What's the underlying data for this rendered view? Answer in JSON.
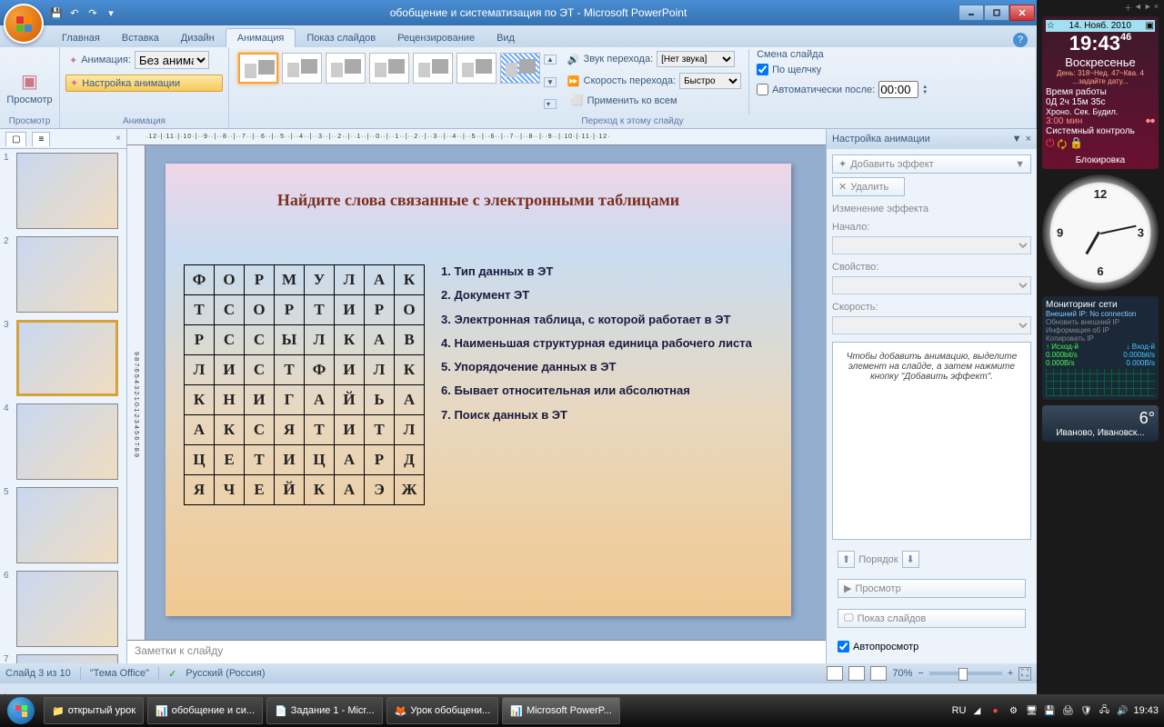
{
  "title": "обобщение и систематизация по ЭТ - Microsoft PowerPoint",
  "tabs": [
    "Главная",
    "Вставка",
    "Дизайн",
    "Анимация",
    "Показ слайдов",
    "Рецензирование",
    "Вид"
  ],
  "active_tab": 3,
  "ribbon": {
    "preview": "Просмотр",
    "anim_label": "Анимация:",
    "anim_value": "Без анимац...",
    "custom_anim": "Настройка анимации",
    "group1": "Просмотр",
    "group2": "Анимация",
    "group3": "Переход к этому слайду",
    "sound_label": "Звук перехода:",
    "sound_value": "[Нет звука]",
    "speed_label": "Скорость перехода:",
    "speed_value": "Быстро",
    "apply_all": "Применить ко всем",
    "slide_change": "Смена слайда",
    "on_click": "По щелчку",
    "auto_after": "Автоматически после:",
    "auto_time": "00:00"
  },
  "slide": {
    "title": "Найдите слова связанные с электронными таблицами",
    "grid": [
      [
        "Ф",
        "О",
        "Р",
        "М",
        "У",
        "Л",
        "А",
        "К"
      ],
      [
        "Т",
        "С",
        "О",
        "Р",
        "Т",
        "И",
        "Р",
        "О"
      ],
      [
        "Р",
        "С",
        "С",
        "Ы",
        "Л",
        "К",
        "А",
        "В"
      ],
      [
        "Л",
        "И",
        "С",
        "Т",
        "Ф",
        "И",
        "Л",
        "К"
      ],
      [
        "К",
        "Н",
        "И",
        "Г",
        "А",
        "Й",
        "Ь",
        "А"
      ],
      [
        "А",
        "К",
        "С",
        "Я",
        "Т",
        "И",
        "Т",
        "Л"
      ],
      [
        "Ц",
        "Е",
        "Т",
        "И",
        "Ц",
        "А",
        "Р",
        "Д"
      ],
      [
        "Я",
        "Ч",
        "Е",
        "Й",
        "К",
        "А",
        "Э",
        "Ж"
      ]
    ],
    "clues": [
      "1. Тип данных в ЭТ",
      "2. Документ ЭТ",
      "3. Электронная таблица, с которой работает в ЭТ",
      "4. Наименьшая структурная единица рабочего листа",
      "5. Упорядочение данных в ЭТ",
      "6. Бывает относительная или абсолютная",
      "7. Поиск данных в ЭТ"
    ]
  },
  "notes_placeholder": "Заметки к слайду",
  "anim_pane": {
    "title": "Настройка анимации",
    "add_effect": "Добавить эффект",
    "delete": "Удалить",
    "modify": "Изменение эффекта",
    "start": "Начало:",
    "property": "Свойство:",
    "speed": "Скорость:",
    "hint": "Чтобы добавить анимацию, выделите элемент на слайде, а затем нажмите кнопку \"Добавить эффект\".",
    "order": "Порядок",
    "preview": "Просмотр",
    "slideshow": "Показ слайдов",
    "autopreview": "Автопросмотр"
  },
  "status": {
    "slide": "Слайд 3 из 10",
    "theme": "\"Тема Office\"",
    "lang": "Русский (Россия)",
    "zoom": "70%"
  },
  "taskbar": {
    "items": [
      "открытый урок",
      "обобщение и си...",
      "Задание 1 - Micr...",
      "Урок обобщени...",
      "Microsoft PowerP..."
    ],
    "lang": "RU",
    "time": "19:43"
  },
  "gadgets": {
    "date": "14. Нояб. 2010",
    "time": "19:43",
    "sec": "46",
    "day": "Воскресенье",
    "dayinfo": "День: 318~Нед. 47~Квa. 4",
    "setdate": "...задайте дату...",
    "uptime_lbl": "Время работы",
    "uptime": "0Д 2ч 15м 35с",
    "chrono": "Хроно.  Сек.  Будил.",
    "chrono_val": "3:00 мин",
    "sys": "Системный контроль",
    "lock": "Блокировка",
    "net_title": "Мониторинг сети",
    "net_ext": "Внешний IP: No connection",
    "net_upd": "Обновить внешний IP",
    "net_info": "Информация об IP",
    "net_copy": "Копировать IP",
    "net_out": "Исход-й",
    "net_in": "Вход-й",
    "net_rate": "0.000bit/s",
    "net_bytes": "0.000B/s",
    "temp": "6°",
    "city": "Иваново, Ивановск..."
  },
  "ruler_h": "·12·|·11·|·10·|··9··|··8··|··7··|··6··|··5··|··4··|··3··|··2··|··1··|··0··|··1··|··2··|··3··|··4··|··5··|··6··|··7··|··8··|··9··|·10·|·11·|·12·",
  "ruler_v": "9·8·7·6·5·4·3·2·1·0·1·2·3·4·5·6·7·8·9"
}
